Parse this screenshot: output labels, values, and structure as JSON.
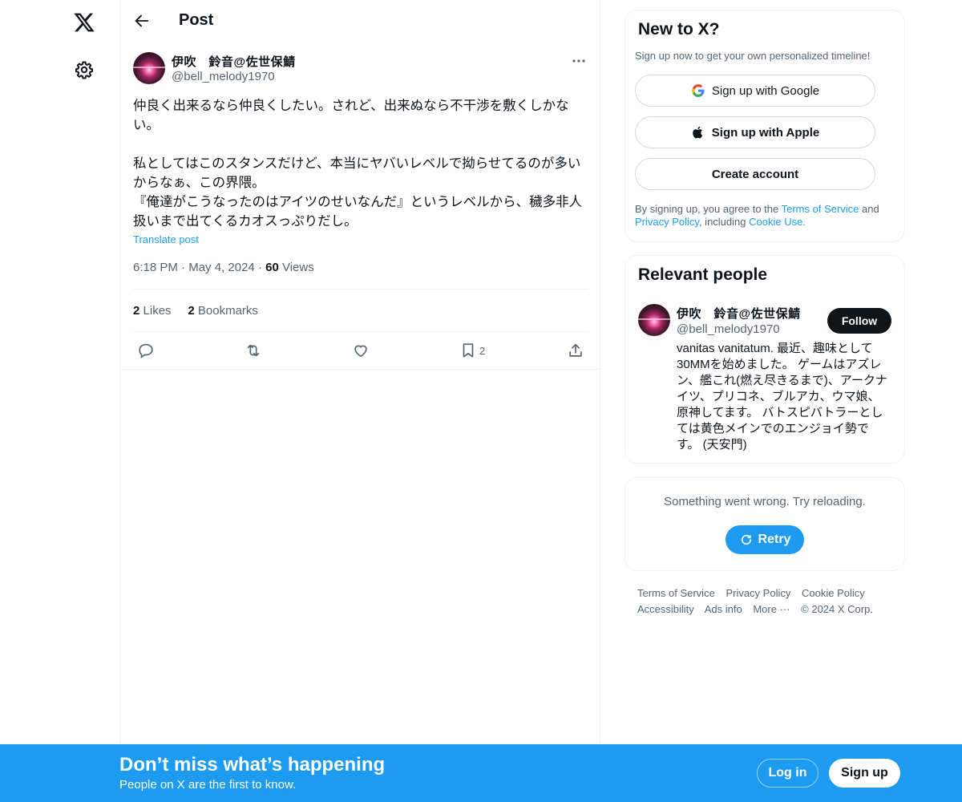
{
  "nav": {
    "logo_icon": "x-logo-icon",
    "settings_icon": "gear-icon"
  },
  "header": {
    "title": "Post",
    "back_icon": "arrow-left-icon"
  },
  "post": {
    "author_name": "伊吹　鈴音@佐世保鯖",
    "author_handle": "@bell_melody1970",
    "paragraph1": "仲良く出来るなら仲良くしたい。されど、出来ぬなら不干渉を敷くしかない。",
    "paragraph2": "私としてはこのスタンスだけど、本当にヤバいレベルで拗らせてるのが多いからなぁ、この界隈。",
    "paragraph3": "『俺達がこうなったのはアイツのせいなんだ』というレベルから、穢多非人扱いまで出てくるカオスっぷりだし。",
    "translate_label": "Translate post",
    "time": "6:18 PM",
    "date": "May 4, 2024",
    "views_count": "60",
    "views_label": "Views",
    "likes_count": "2",
    "likes_label": "Likes",
    "bookmarks_count": "2",
    "bookmarks_label": "Bookmarks",
    "action_bookmark_count": "2"
  },
  "signup_card": {
    "title": "New to X?",
    "subtitle": "Sign up now to get your own personalized timeline!",
    "google_label": "Sign up with Google",
    "apple_label": "Sign up with Apple",
    "create_label": "Create account",
    "legal_prefix": "By signing up, you agree to the ",
    "terms_link": "Terms of Service",
    "legal_and": " and ",
    "privacy_link": "Privacy Policy",
    "legal_including": ", including ",
    "cookie_link": "Cookie Use."
  },
  "relevant": {
    "title": "Relevant people",
    "name": "伊吹　鈴音@佐世保鯖",
    "handle": "@bell_melody1970",
    "follow_label": "Follow",
    "bio": "vanitas vanitatum. 最近、趣味として30MMを始めました。 ゲームはアズレン、艦これ(燃え尽きるまで)、アークナイツ、プリコネ、ブルアカ、ウマ娘、原神してます。 バトスピバトラーとしては黄色メインでのエンジョイ勢です。 (天安門)"
  },
  "error_card": {
    "message": "Something went wrong. Try reloading.",
    "retry_label": "Retry"
  },
  "footer": {
    "links": [
      "Terms of Service",
      "Privacy Policy",
      "Cookie Policy",
      "Accessibility",
      "Ads info",
      "More ···",
      "© 2024 X Corp."
    ]
  },
  "bottom_bar": {
    "title": "Don’t miss what’s happening",
    "subtitle": "People on X are the first to know.",
    "login_label": "Log in",
    "signup_label": "Sign up"
  },
  "colors": {
    "accent": "#1d9bf0",
    "text": "#0f1419",
    "muted": "#536471",
    "border": "#eff3f4"
  }
}
